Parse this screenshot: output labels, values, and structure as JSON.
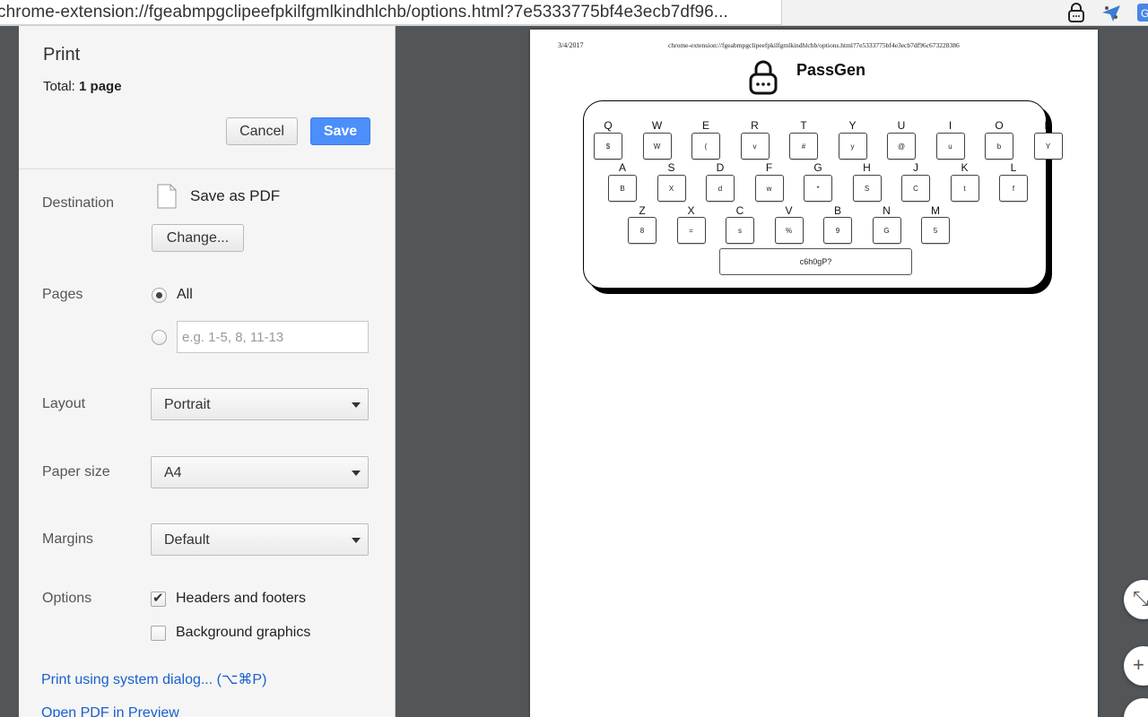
{
  "browser": {
    "url": "chrome-extension://fgeabmpgclipeefpkilfgmlkindhlchb/options.html?7e5333775bf4e3ecb7df96...",
    "extensions": [
      "lock-icon",
      "plane-icon",
      "google-translate-icon"
    ]
  },
  "print_panel": {
    "title": "Print",
    "total_label": "Total:",
    "total_value": "1 page",
    "cancel_label": "Cancel",
    "save_label": "Save",
    "destination": {
      "label": "Destination",
      "name": "Save as PDF",
      "change_label": "Change..."
    },
    "pages": {
      "label": "Pages",
      "all_label": "All",
      "custom_placeholder": "e.g. 1-5, 8, 11-13"
    },
    "layout": {
      "label": "Layout",
      "value": "Portrait"
    },
    "paper_size": {
      "label": "Paper size",
      "value": "A4"
    },
    "margins": {
      "label": "Margins",
      "value": "Default"
    },
    "options": {
      "label": "Options",
      "headers_footers": "Headers and footers",
      "headers_footers_checked": true,
      "background_graphics": "Background graphics",
      "background_graphics_checked": false
    },
    "system_dialog_link": "Print using system dialog... (⌥⌘P)",
    "open_pdf_link": "Open PDF in Preview"
  },
  "preview": {
    "header_date": "3/4/2017",
    "header_url": "chrome-extension://fgeabmpgclipeefpkilfgmlkindhlchb/options.html?7e5333775bf4e3ecb7df96c673228386",
    "app_title": "PassGen",
    "rows": [
      {
        "letters": [
          "Q",
          "W",
          "E",
          "R",
          "T",
          "Y",
          "U",
          "I",
          "O",
          "P"
        ],
        "keys": [
          "$",
          "W",
          "(",
          "v",
          "#",
          "y",
          "@",
          "u",
          "b",
          "Y"
        ]
      },
      {
        "letters": [
          "A",
          "S",
          "D",
          "F",
          "G",
          "H",
          "J",
          "K",
          "L"
        ],
        "keys": [
          "B",
          "X",
          "d",
          "w",
          "*",
          "S",
          "C",
          "t",
          "f"
        ]
      },
      {
        "letters": [
          "Z",
          "X",
          "C",
          "V",
          "B",
          "N",
          "M"
        ],
        "keys": [
          "8",
          "=",
          "s",
          "%",
          "9",
          "G",
          "5"
        ]
      }
    ],
    "password": "c6h0gP?"
  },
  "zoom": {
    "fit_label": "fit",
    "plus_label": "+"
  }
}
